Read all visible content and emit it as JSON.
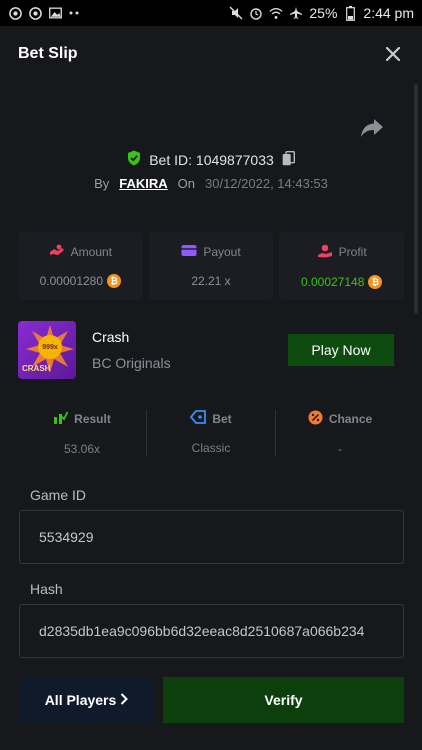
{
  "status_bar": {
    "battery": "25%",
    "time": "2:44 pm"
  },
  "header": {
    "title": "Bet Slip",
    "close_icon": "close-icon"
  },
  "bet": {
    "id_label": "Bet ID: 1049877033",
    "by_label": "By",
    "user": "FAKIRA",
    "on_label": "On",
    "datetime": "30/12/2022, 14:43:53"
  },
  "stats": {
    "amount_label": "Amount",
    "amount_value": "0.00001280",
    "payout_label": "Payout",
    "payout_value": "22.21 x",
    "profit_label": "Profit",
    "profit_value": "0.00027148"
  },
  "game": {
    "name": "Crash",
    "provider": "BC Originals",
    "thumb_text": "CRASH",
    "thumb_badge": "999x",
    "play_label": "Play Now"
  },
  "meta": {
    "result_label": "Result",
    "result_value": "53.06x",
    "bet_label": "Bet",
    "bet_value": "Classic",
    "chance_label": "Chance",
    "chance_value": "-"
  },
  "fields": {
    "game_id_label": "Game ID",
    "game_id_value": "5534929",
    "hash_label": "Hash",
    "hash_value": "d2835db1ea9c096bb6d32eeac8d2510687a066b234"
  },
  "actions": {
    "all_players_label": "All Players",
    "verify_label": "Verify"
  },
  "colors": {
    "panel_bg": "#16181c",
    "profit_green": "#3bc117",
    "button_green": "#0e4b0e",
    "btc_orange": "#f7931a"
  }
}
